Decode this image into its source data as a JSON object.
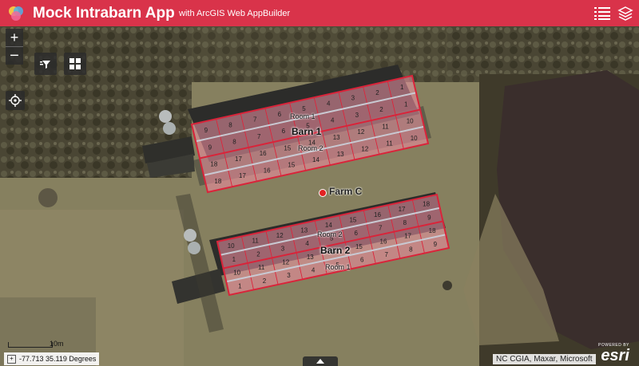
{
  "header": {
    "title": "Mock Intrabarn App",
    "subtitle": "with ArcGIS Web AppBuilder",
    "logo_icon": "app-logo-icon",
    "list_icon": "list-icon",
    "layers_icon": "layers-icon",
    "color": "#d9334a"
  },
  "map_controls": {
    "zoom_in": "+",
    "zoom_out": "−",
    "filter_icon": "filter-icon",
    "grid_icon": "grid-icon",
    "locate_icon": "locate-icon"
  },
  "map": {
    "farm_label": "Farm C",
    "farm_marker_color": "#e22222",
    "outline_color": "#d9243a",
    "barns": [
      {
        "label": "Barn 1",
        "rooms": [
          "Room 1",
          "Room 2"
        ],
        "rows": [
          [
            "9",
            "8",
            "7",
            "6",
            "5",
            "4",
            "3",
            "2",
            "1"
          ],
          [
            "9",
            "8",
            "7",
            "6",
            "5",
            "4",
            "3",
            "2",
            "1"
          ],
          [
            "18",
            "17",
            "16",
            "15",
            "14",
            "13",
            "12",
            "11",
            "10"
          ],
          [
            "18",
            "17",
            "16",
            "15",
            "14",
            "13",
            "12",
            "11",
            "10"
          ]
        ]
      },
      {
        "label": "Barn 2",
        "rooms": [
          "Room 2",
          "Room 1"
        ],
        "rows": [
          [
            "10",
            "11",
            "12",
            "13",
            "14",
            "15",
            "16",
            "17",
            "18"
          ],
          [
            "1",
            "2",
            "3",
            "4",
            "5",
            "6",
            "7",
            "8",
            "9"
          ],
          [
            "10",
            "11",
            "12",
            "13",
            "14",
            "15",
            "16",
            "17",
            "18"
          ],
          [
            "1",
            "2",
            "3",
            "4",
            "5",
            "6",
            "7",
            "8",
            "9"
          ]
        ]
      }
    ]
  },
  "scale": {
    "label": "10m"
  },
  "coordinates": {
    "toggle": "+",
    "text": "-77.713 35.119 Degrees"
  },
  "attribution": "NC CGIA, Maxar, Microsoft",
  "esri": {
    "powered_by": "POWERED BY",
    "brand": "esri"
  }
}
